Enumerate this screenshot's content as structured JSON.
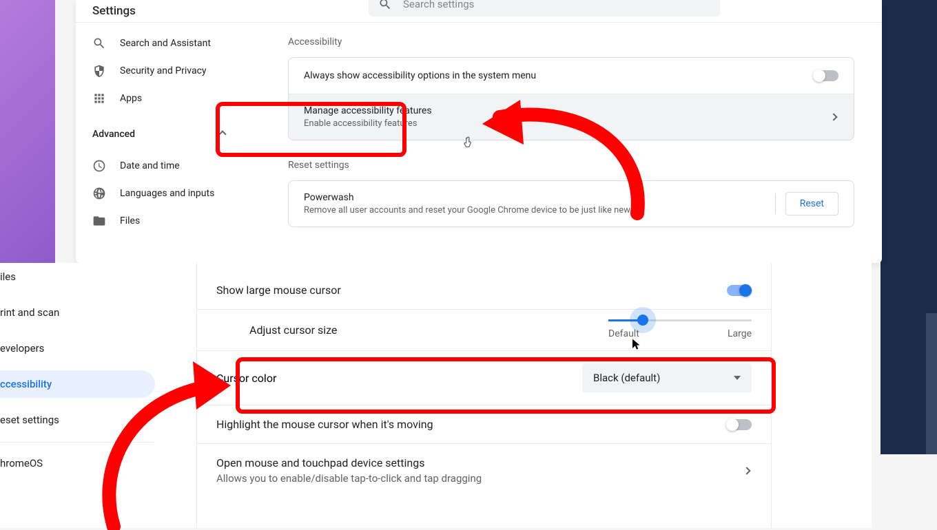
{
  "header": {
    "title": "Settings",
    "search_placeholder": "Search settings"
  },
  "sidebar_top": {
    "search_assistant": "Search and Assistant",
    "security_privacy": "Security and Privacy",
    "apps": "Apps",
    "advanced": "Advanced",
    "date_time": "Date and time",
    "languages_inputs": "Languages and inputs",
    "files": "Files"
  },
  "accessibility_section": {
    "heading": "Accessibility",
    "row_always_show": "Always show accessibility options in the system menu",
    "row_manage_title": "Manage accessibility features",
    "row_manage_sub": "Enable accessibility features"
  },
  "reset_section": {
    "heading": "Reset settings",
    "powerwash_title": "Powerwash",
    "powerwash_sub": "Remove all user accounts and reset your Google Chrome device to be just like new.",
    "reset_button": "Reset"
  },
  "sidebar_bottom": {
    "files": "iles",
    "print_scan": "rint and scan",
    "developers": "evelopers",
    "accessibility": "ccessibility",
    "reset_settings": "eset settings",
    "chromeos": "hromeOS"
  },
  "mouse_section": {
    "show_large_cursor": "Show large mouse cursor",
    "adjust_cursor_size": "Adjust cursor size",
    "slider_min": "Default",
    "slider_max": "Large",
    "cursor_color_label": "Cursor color",
    "cursor_color_value": "Black (default)",
    "highlight_moving": "Highlight the mouse cursor when it's moving",
    "open_mouse_title": "Open mouse and touchpad device settings",
    "open_mouse_sub": "Allows you to enable/disable tap-to-click and tap dragging"
  }
}
